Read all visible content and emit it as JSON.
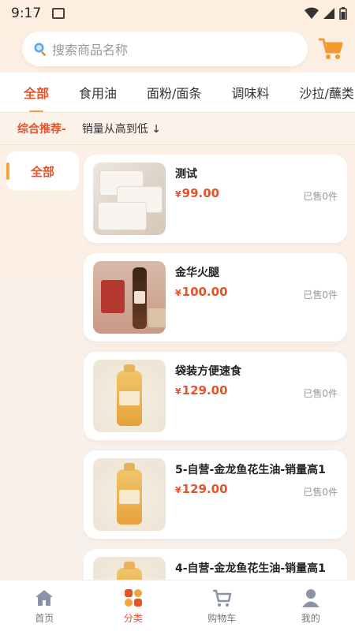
{
  "status": {
    "time": "9:17"
  },
  "search": {
    "placeholder": "搜索商品名称"
  },
  "tabs": [
    "全部",
    "食用油",
    "面粉/面条",
    "调味料",
    "沙拉/蘸类"
  ],
  "active_tab": "全部",
  "sort": {
    "primary": "综合推荐-",
    "secondary": "销量从高到低 ↓"
  },
  "sidebar": {
    "items": [
      "全部"
    ]
  },
  "products": [
    {
      "name": "测试",
      "currency": "¥",
      "price": "99.00",
      "sold": "已售0件"
    },
    {
      "name": "金华火腿",
      "currency": "¥",
      "price": "100.00",
      "sold": "已售0件"
    },
    {
      "name": "袋装方便速食",
      "currency": "¥",
      "price": "129.00",
      "sold": "已售0件"
    },
    {
      "name": "5-自营-金龙鱼花生油-销量高1",
      "currency": "¥",
      "price": "129.00",
      "sold": "已售0件"
    },
    {
      "name": "4-自营-金龙鱼花生油-销量高1",
      "currency": "¥",
      "price": "",
      "sold": ""
    }
  ],
  "tabbar": {
    "items": [
      "首页",
      "分类",
      "购物车",
      "我的"
    ],
    "active": "分类"
  },
  "colors": {
    "accent": "#e4532b",
    "indicator": "#f5a33b",
    "cart_icon": "#f39a2e"
  }
}
